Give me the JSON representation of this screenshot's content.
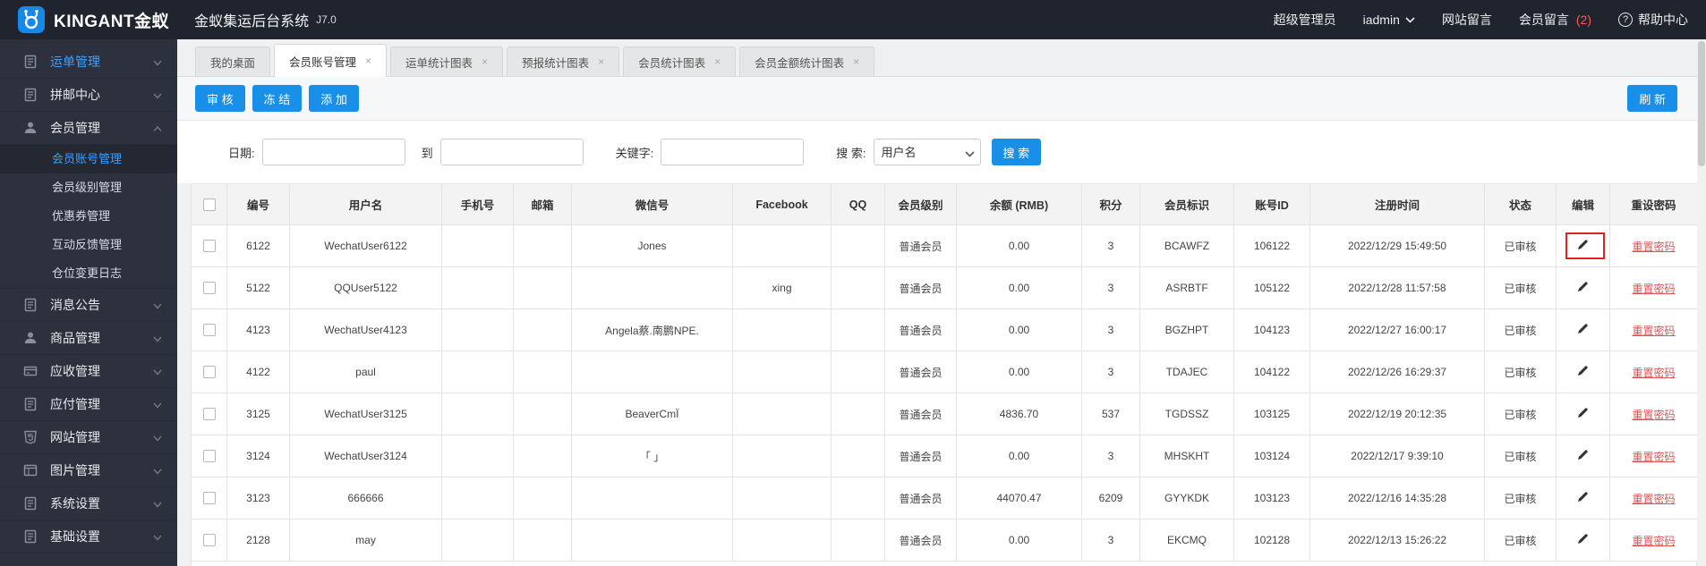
{
  "colors": {
    "accent": "#1890e9",
    "link_red": "#e25252",
    "active_blue": "#3da0ff",
    "badge_red": "#ff5a50",
    "topbar_bg": "#20242e",
    "sidebar_bg": "#2c313d"
  },
  "icons": {
    "close": "×",
    "help": "?"
  },
  "topbar": {
    "brand": "KINGANT金蚁",
    "app_title": "金蚁集运后台系统",
    "version": "J7.0",
    "role": "超级管理员",
    "username": "iadmin",
    "site_messages": "网站留言",
    "member_messages": "会员留言",
    "member_messages_count": "(2)",
    "help": "帮助中心"
  },
  "sidebar": {
    "items": [
      {
        "label": "运单管理",
        "icon": "doc-icon",
        "state": "collapsed",
        "highlight": true
      },
      {
        "label": "拼邮中心",
        "icon": "doc-icon",
        "state": "collapsed"
      },
      {
        "label": "会员管理",
        "icon": "user-icon",
        "state": "expanded",
        "children": [
          {
            "label": "会员账号管理",
            "active": true
          },
          {
            "label": "会员级别管理"
          },
          {
            "label": "优惠券管理"
          },
          {
            "label": "互动反馈管理"
          },
          {
            "label": "仓位变更日志"
          }
        ]
      },
      {
        "label": "消息公告",
        "icon": "doc-icon",
        "state": "collapsed"
      },
      {
        "label": "商品管理",
        "icon": "user-icon",
        "state": "collapsed"
      },
      {
        "label": "应收管理",
        "icon": "card-icon",
        "state": "collapsed"
      },
      {
        "label": "应付管理",
        "icon": "doc-icon",
        "state": "collapsed"
      },
      {
        "label": "网站管理",
        "icon": "html5-icon",
        "state": "collapsed"
      },
      {
        "label": "图片管理",
        "icon": "image-icon",
        "state": "collapsed"
      },
      {
        "label": "系统设置",
        "icon": "doc-icon",
        "state": "collapsed"
      },
      {
        "label": "基础设置",
        "icon": "doc-icon",
        "state": "collapsed"
      }
    ]
  },
  "tabs": [
    {
      "label": "我的桌面",
      "closable": false,
      "active": false
    },
    {
      "label": "会员账号管理",
      "closable": true,
      "active": true
    },
    {
      "label": "运单统计图表",
      "closable": true,
      "active": false
    },
    {
      "label": "预报统计图表",
      "closable": true,
      "active": false
    },
    {
      "label": "会员统计图表",
      "closable": true,
      "active": false
    },
    {
      "label": "会员金额统计图表",
      "closable": true,
      "active": false
    }
  ],
  "toolbar": {
    "audit": "审 核",
    "freeze": "冻 结",
    "add": "添 加",
    "refresh": "刷 新"
  },
  "search": {
    "date_label": "日期:",
    "to_label": "到",
    "keyword_label": "关键字:",
    "search_label": "搜 索:",
    "field_selected": "用户名",
    "button": "搜 索",
    "date_from": "",
    "date_to": "",
    "keyword": ""
  },
  "table": {
    "columns": [
      "编号",
      "用户名",
      "手机号",
      "邮箱",
      "微信号",
      "Facebook",
      "QQ",
      "会员级别",
      "余额 (RMB)",
      "积分",
      "会员标识",
      "账号ID",
      "注册时间",
      "状态",
      "编辑",
      "重设密码"
    ],
    "reset_link_label": "重置密码",
    "rows": [
      {
        "id": "6122",
        "username": "WechatUser6122",
        "phone": "",
        "email": "",
        "wechat": "Jones",
        "facebook": "",
        "qq": "",
        "level": "普通会员",
        "balance": "0.00",
        "points": "3",
        "member_code": "BCAWFZ",
        "account_id": "106122",
        "reg_time": "2022/12/29 15:49:50",
        "status": "已审核",
        "edit_highlighted": true
      },
      {
        "id": "5122",
        "username": "QQUser5122",
        "phone": "",
        "email": "",
        "wechat": "",
        "facebook": "xing",
        "qq": "",
        "level": "普通会员",
        "balance": "0.00",
        "points": "3",
        "member_code": "ASRBTF",
        "account_id": "105122",
        "reg_time": "2022/12/28 11:57:58",
        "status": "已审核",
        "edit_highlighted": false
      },
      {
        "id": "4123",
        "username": "WechatUser4123",
        "phone": "",
        "email": "",
        "wechat": "Angela蔡.南鹏NPE.",
        "facebook": "",
        "qq": "",
        "level": "普通会员",
        "balance": "0.00",
        "points": "3",
        "member_code": "BGZHPT",
        "account_id": "104123",
        "reg_time": "2022/12/27 16:00:17",
        "status": "已审核",
        "edit_highlighted": false
      },
      {
        "id": "4122",
        "username": "paul",
        "phone": "",
        "email": "",
        "wechat": "",
        "facebook": "",
        "qq": "",
        "level": "普通会员",
        "balance": "0.00",
        "points": "3",
        "member_code": "TDAJEC",
        "account_id": "104122",
        "reg_time": "2022/12/26 16:29:37",
        "status": "已审核",
        "edit_highlighted": false
      },
      {
        "id": "3125",
        "username": "WechatUser3125",
        "phone": "",
        "email": "",
        "wechat": "BeaverCmÏ",
        "facebook": "",
        "qq": "",
        "level": "普通会员",
        "balance": "4836.70",
        "points": "537",
        "member_code": "TGDSSZ",
        "account_id": "103125",
        "reg_time": "2022/12/19 20:12:35",
        "status": "已审核",
        "edit_highlighted": false
      },
      {
        "id": "3124",
        "username": "WechatUser3124",
        "phone": "",
        "email": "",
        "wechat": "「 」",
        "facebook": "",
        "qq": "",
        "level": "普通会员",
        "balance": "0.00",
        "points": "3",
        "member_code": "MHSKHT",
        "account_id": "103124",
        "reg_time": "2022/12/17 9:39:10",
        "status": "已审核",
        "edit_highlighted": false
      },
      {
        "id": "3123",
        "username": "666666",
        "phone": "",
        "email": "",
        "wechat": "",
        "facebook": "",
        "qq": "",
        "level": "普通会员",
        "balance": "44070.47",
        "points": "6209",
        "member_code": "GYYKDK",
        "account_id": "103123",
        "reg_time": "2022/12/16 14:35:28",
        "status": "已审核",
        "edit_highlighted": false
      },
      {
        "id": "2128",
        "username": "may",
        "phone": "",
        "email": "",
        "wechat": "",
        "facebook": "",
        "qq": "",
        "level": "普通会员",
        "balance": "0.00",
        "points": "3",
        "member_code": "EKCMQ",
        "account_id": "102128",
        "reg_time": "2022/12/13 15:26:22",
        "status": "已审核",
        "edit_highlighted": false
      }
    ]
  }
}
